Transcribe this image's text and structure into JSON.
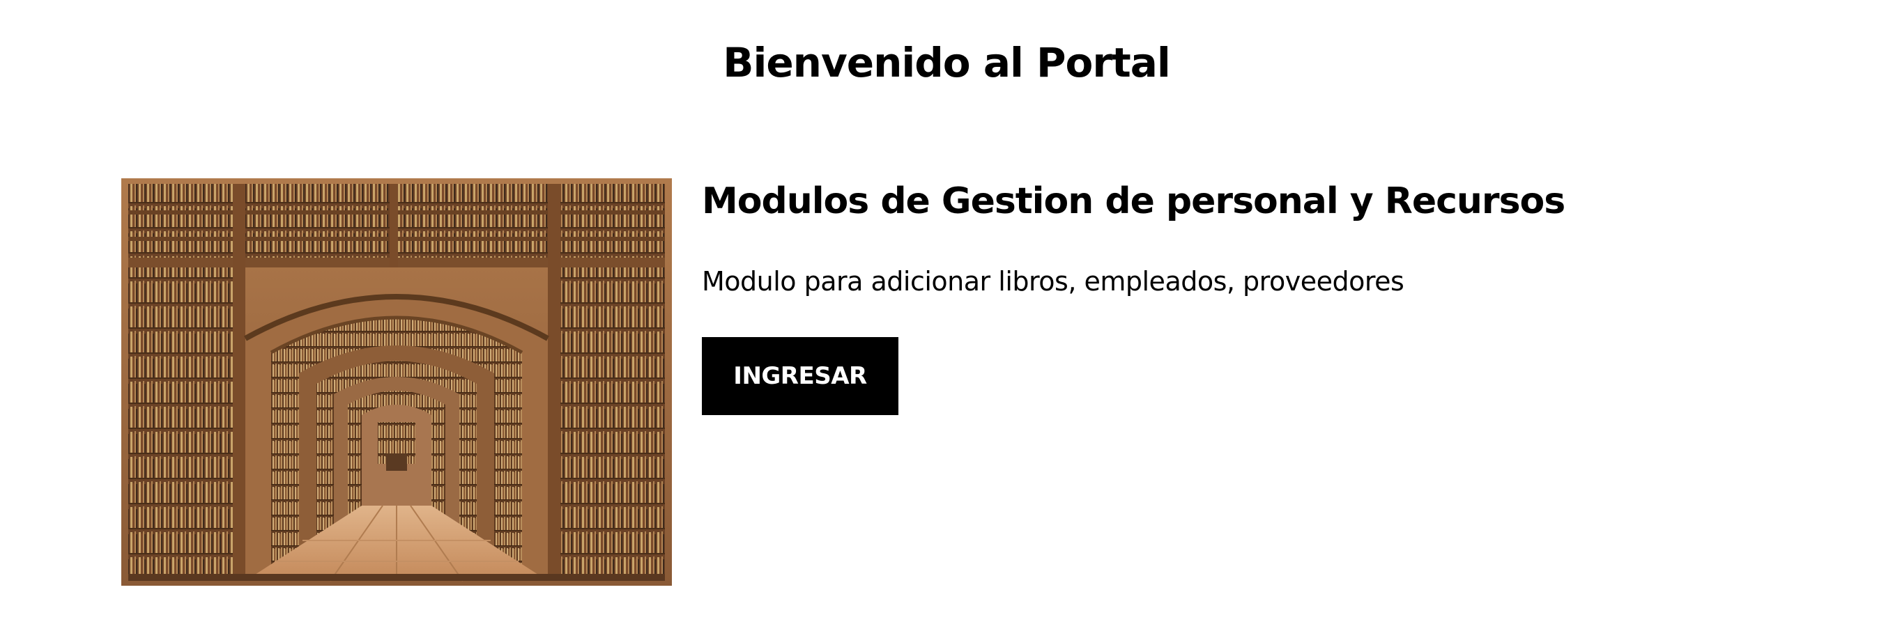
{
  "header": {
    "title": "Bienvenido al Portal"
  },
  "card": {
    "image_name": "library-bookshelves-arches",
    "title": "Modulos de Gestion de personal y Recursos",
    "description": "Modulo para adicionar libros, empleados, proveedores",
    "button_label": "INGRESAR"
  },
  "colors": {
    "background": "#ffffff",
    "text": "#000000",
    "button_bg": "#000000",
    "button_text": "#ffffff",
    "wood_dark": "#5a3a22",
    "wood_light": "#c08a5c"
  }
}
